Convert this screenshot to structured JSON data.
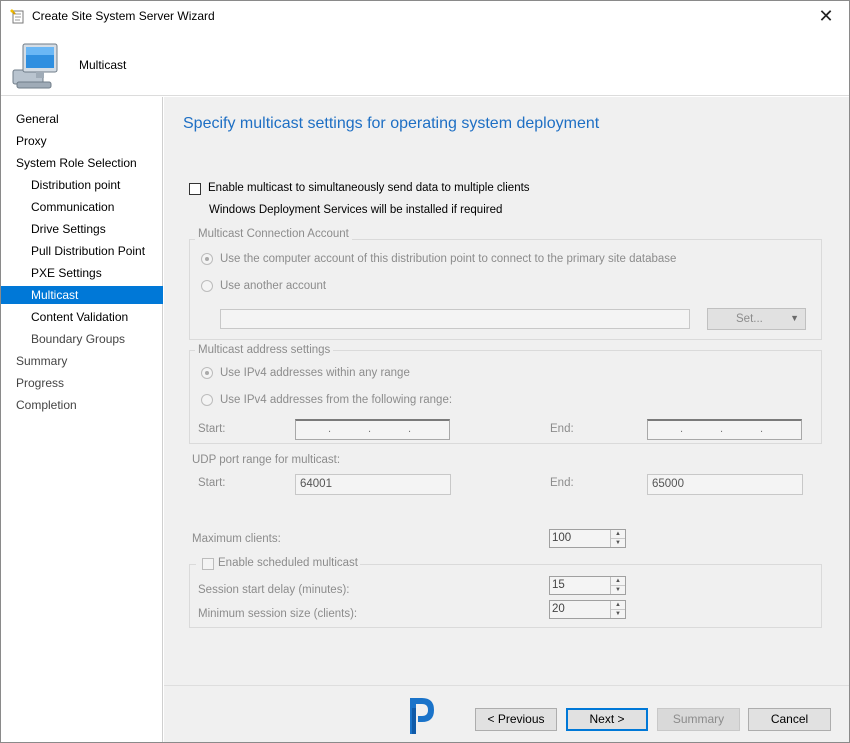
{
  "window": {
    "title": "Create Site System Server Wizard",
    "close_glyph": "✕"
  },
  "header": {
    "title": "Multicast"
  },
  "nav": {
    "items": [
      {
        "label": "General",
        "level": 1,
        "active": false
      },
      {
        "label": "Proxy",
        "level": 1,
        "active": false
      },
      {
        "label": "System Role Selection",
        "level": 1,
        "active": false
      },
      {
        "label": "Distribution point",
        "level": 2,
        "active": false
      },
      {
        "label": "Communication",
        "level": 2,
        "active": false
      },
      {
        "label": "Drive Settings",
        "level": 2,
        "active": false
      },
      {
        "label": "Pull Distribution Point",
        "level": 2,
        "active": false
      },
      {
        "label": "PXE Settings",
        "level": 2,
        "active": false
      },
      {
        "label": "Multicast",
        "level": 2,
        "active": true
      },
      {
        "label": "Content Validation",
        "level": 2,
        "active": false
      },
      {
        "label": "Boundary Groups",
        "level": 2,
        "active": false
      },
      {
        "label": "Summary",
        "level": 1,
        "active": false
      },
      {
        "label": "Progress",
        "level": 1,
        "active": false
      },
      {
        "label": "Completion",
        "level": 1,
        "active": false
      }
    ]
  },
  "main": {
    "title": "Specify multicast settings for operating system deployment",
    "enable_multicast": {
      "label": "Enable multicast to simultaneously send data to multiple clients",
      "checked": false
    },
    "wds_note": "Windows Deployment Services will be installed if required",
    "connection_account": {
      "group_label": "Multicast Connection Account",
      "option_computer": "Use the computer account of this distribution point to connect to the primary site database",
      "option_another": "Use another account",
      "account_value": "",
      "set_button": "Set...",
      "set_arrow": "▼"
    },
    "address_settings": {
      "group_label": "Multicast address settings",
      "option_any": "Use IPv4 addresses within any range",
      "option_range": "Use IPv4 addresses from the following range:",
      "start_label": "Start:",
      "end_label": "End:",
      "ip_dots": "."
    },
    "udp": {
      "label": "UDP port range for multicast:",
      "start_label": "Start:",
      "start_value": "64001",
      "end_label": "End:",
      "end_value": "65000"
    },
    "max_clients": {
      "label": "Maximum clients:",
      "value": "100"
    },
    "scheduled": {
      "label": "Enable scheduled multicast",
      "checked": false,
      "delay_label": "Session start delay (minutes):",
      "delay_value": "15",
      "min_size_label": "Minimum session size (clients):",
      "min_size_value": "20"
    },
    "spin_up": "▲",
    "spin_down": "▼"
  },
  "footer": {
    "previous": "< Previous",
    "next": "Next >",
    "summary": "Summary",
    "cancel": "Cancel"
  },
  "colors": {
    "accent": "#0078d7",
    "title_blue": "#1e6fc4",
    "logo_blue": "#1a73c9"
  },
  "icons": {
    "title": "wizard-icon",
    "header": "computer-monitor-icon",
    "logo": "brand-logo"
  }
}
